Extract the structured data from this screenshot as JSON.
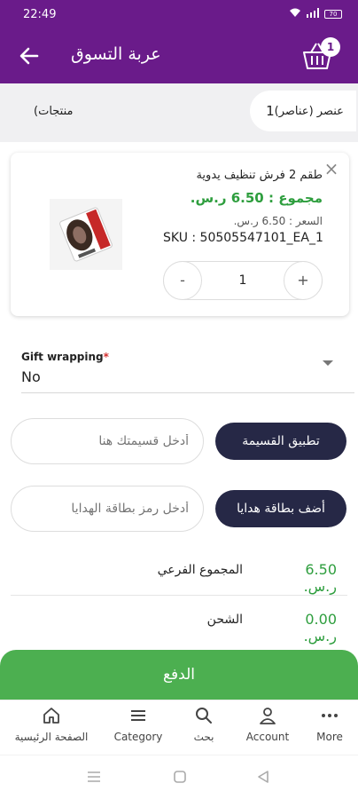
{
  "status_bar": {
    "time": "22:49",
    "battery": "70"
  },
  "header": {
    "title": "عربة التسوق",
    "cart_count": "1"
  },
  "summary": {
    "items_label": "عنصر (عناصر)",
    "items_count": "1",
    "products_label": "(منتجات"
  },
  "cart_item": {
    "name": "طقم 2 فرش تنظيف يدوية",
    "total": "مجموع : 6.50 ر.س.",
    "price": "السعر : 6.50 ر.س.",
    "sku": "SKU : 50505547101_EA_1",
    "quantity": "1",
    "minus_label": "-",
    "plus_label": "+",
    "remove_label": "×"
  },
  "gift_wrapping": {
    "label": "Gift wrapping",
    "required_mark": "*",
    "value": "No"
  },
  "coupon": {
    "placeholder": "أدخل قسيمتك هنا",
    "button": "تطبيق القسيمة"
  },
  "gift_card": {
    "placeholder": "أدخل رمز بطاقة الهدايا",
    "button": "أضف بطاقة هدايا"
  },
  "totals": {
    "subtotal_label": "المجموع الفرعي",
    "subtotal_value": "6.50 ر.س.",
    "shipping_label": "الشحن",
    "shipping_value": "0.00 ر.س."
  },
  "checkout": {
    "label": "الدفع"
  },
  "bottom_nav": [
    {
      "label": "الصفحة الرئيسية",
      "icon": "home-icon"
    },
    {
      "label": "Category",
      "icon": "menu-icon"
    },
    {
      "label": "بحث",
      "icon": "search-icon"
    },
    {
      "label": "Account",
      "icon": "person-icon"
    },
    {
      "label": "More",
      "icon": "more-icon"
    }
  ],
  "colors": {
    "primary": "#6a1b8a",
    "accent_green": "#2e9e3e",
    "checkout_green": "#4caf50",
    "dark_button": "#262846"
  }
}
